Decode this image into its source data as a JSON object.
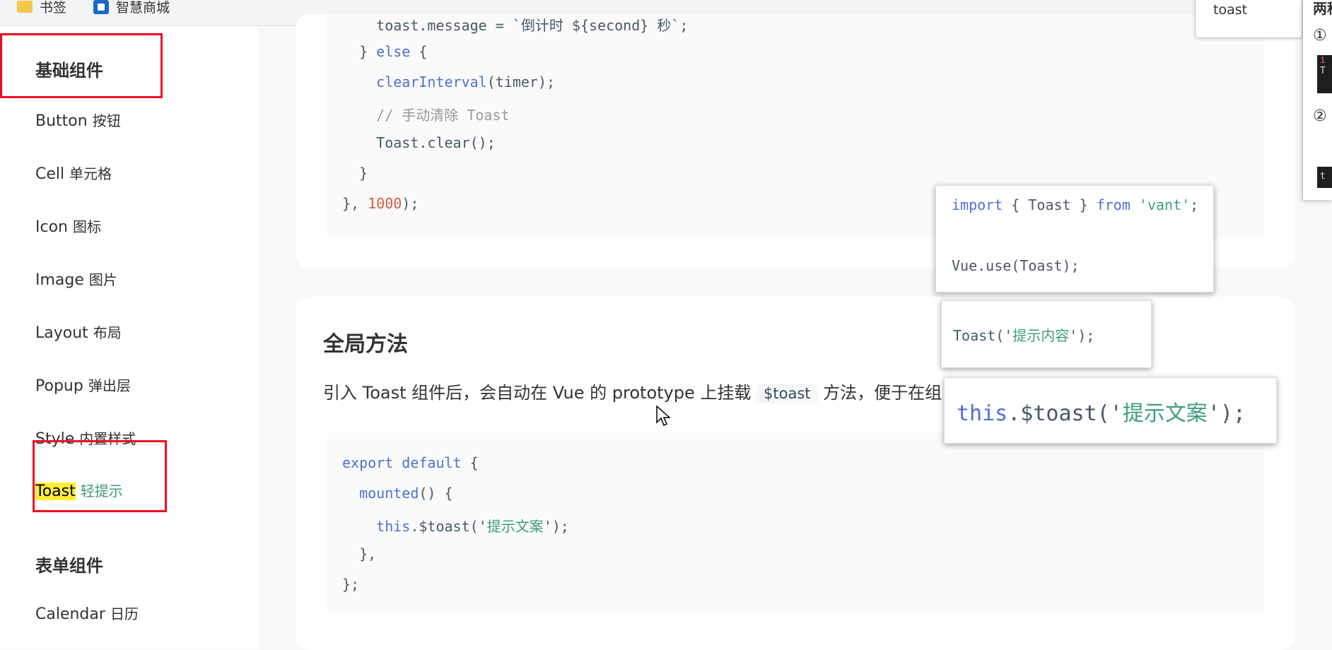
{
  "bookmarks": [
    {
      "label": "书签",
      "icon": "folder-icon"
    },
    {
      "label": "智慧商城",
      "icon": "shop-icon"
    }
  ],
  "search_popup": {
    "text": "toast"
  },
  "right_panel": {
    "title": "两种",
    "step1": "①",
    "step2": "②",
    "code1a": "i",
    "code1b": "T",
    "code2": "t"
  },
  "sidebar": {
    "group1": "基础组件",
    "items": [
      {
        "name": "Button",
        "cn": "按钮"
      },
      {
        "name": "Cell",
        "cn": "单元格"
      },
      {
        "name": "Icon",
        "cn": "图标"
      },
      {
        "name": "Image",
        "cn": "图片"
      },
      {
        "name": "Layout",
        "cn": "布局"
      },
      {
        "name": "Popup",
        "cn": "弹出层"
      },
      {
        "name": "Style",
        "cn": "内置样式"
      },
      {
        "name": "Toast",
        "cn": "轻提示"
      }
    ],
    "group2": "表单组件",
    "items2": [
      {
        "name": "Calendar",
        "cn": "日历"
      }
    ]
  },
  "code_top": {
    "line0": "    toast.message = `倒计时 ${second} 秒`;",
    "line1_a": "  } ",
    "line1_kw": "else",
    "line1_b": " {",
    "line2_fn": "    clearInterval",
    "line2_b": "(timer);",
    "line3": "    // 手动清除 Toast",
    "line4": "    Toast.clear();",
    "line5": "  }",
    "line6_a": "}, ",
    "line6_num": "1000",
    "line6_b": ");"
  },
  "section": {
    "title": "全局方法",
    "para_a": "引入 Toast 组件后，会自动在 Vue 的 prototype 上挂载 ",
    "para_code": "$toast",
    "para_b": " 方法，便于在组"
  },
  "code_bottom": {
    "l1_kw": "export default",
    "l1_b": " {",
    "l2_fn": "  mounted",
    "l2_b": "() {",
    "l3_kw": "    this",
    "l3_b": ".$toast('",
    "l3_str": "提示文案",
    "l3_c": "');",
    "l4": "  },",
    "l5": "};"
  },
  "popups": {
    "p1_l1_kw": "import",
    "p1_l1_b": " { Toast } ",
    "p1_l1_kw2": "from",
    "p1_l1_str": " 'vant'",
    "p1_l1_c": ";",
    "p1_l2": "Vue.use(Toast);",
    "p2_a": "Toast('",
    "p2_str": "提示内容",
    "p2_b": "');",
    "p3_kw": "this",
    "p3_a": ".$toast('",
    "p3_str": "提示文案",
    "p3_b": "');"
  }
}
